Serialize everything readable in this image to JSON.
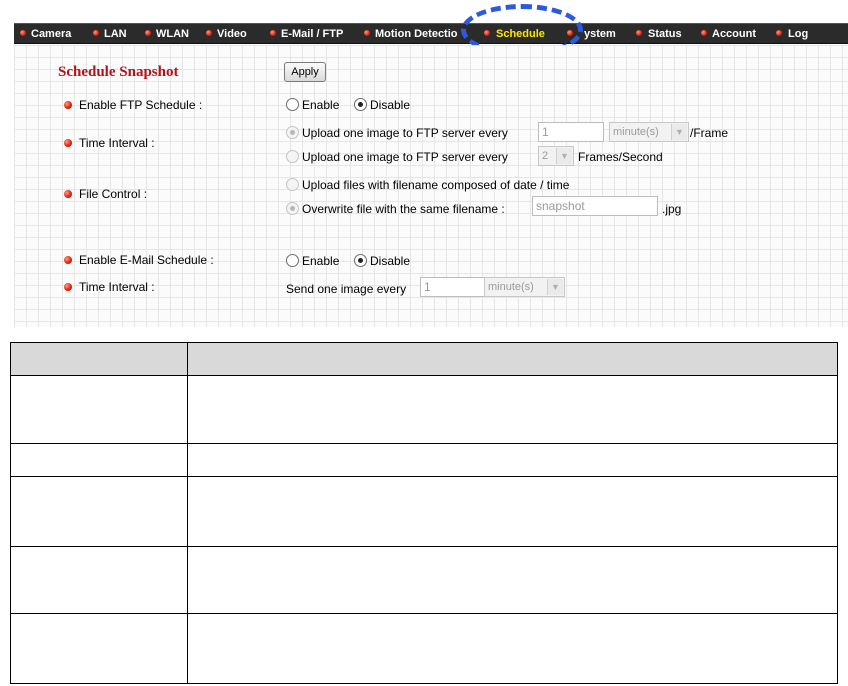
{
  "nav": {
    "items": [
      {
        "label": "Camera"
      },
      {
        "label": "LAN"
      },
      {
        "label": "WLAN"
      },
      {
        "label": "Video"
      },
      {
        "label": "E-Mail / FTP"
      },
      {
        "label": "Motion Detectio"
      },
      {
        "label": "Schedule"
      },
      {
        "label": "ystem"
      },
      {
        "label": "Status"
      },
      {
        "label": "Account"
      },
      {
        "label": "Log"
      }
    ],
    "active": "Schedule",
    "highlight_color": "#2b59e0"
  },
  "schedule": {
    "title": "Schedule Snapshot",
    "apply_label": "Apply",
    "ftp_schedule": {
      "label": "Enable FTP Schedule :",
      "enable_label": "Enable",
      "disable_label": "Disable",
      "selected": "Disable"
    },
    "time_interval": {
      "label": "Time Interval :",
      "option1_label": "Upload one image to FTP server every",
      "option1_value": "1",
      "option1_unit": "minute(s)",
      "option1_suffix": "/Frame",
      "option2_label": "Upload one image to FTP server every",
      "option2_value": "2",
      "option2_suffix": "Frames/Second"
    },
    "file_control": {
      "label": "File Control :",
      "option1_label": "Upload files with filename composed of date / time",
      "option2_label": "Overwrite file with the same filename :",
      "filename_value": "snapshot",
      "extension": ".jpg"
    },
    "email_schedule": {
      "label": "Enable E-Mail Schedule :",
      "enable_label": "Enable",
      "disable_label": "Disable",
      "selected": "Disable"
    },
    "email_interval": {
      "label": "Time Interval :",
      "prefix": "Send one image every",
      "value": "1",
      "unit": "minute(s)"
    }
  },
  "colors": {
    "title_red": "#b0131b",
    "nav_background": "#2b2b2b",
    "nav_active": "#ffe600"
  }
}
